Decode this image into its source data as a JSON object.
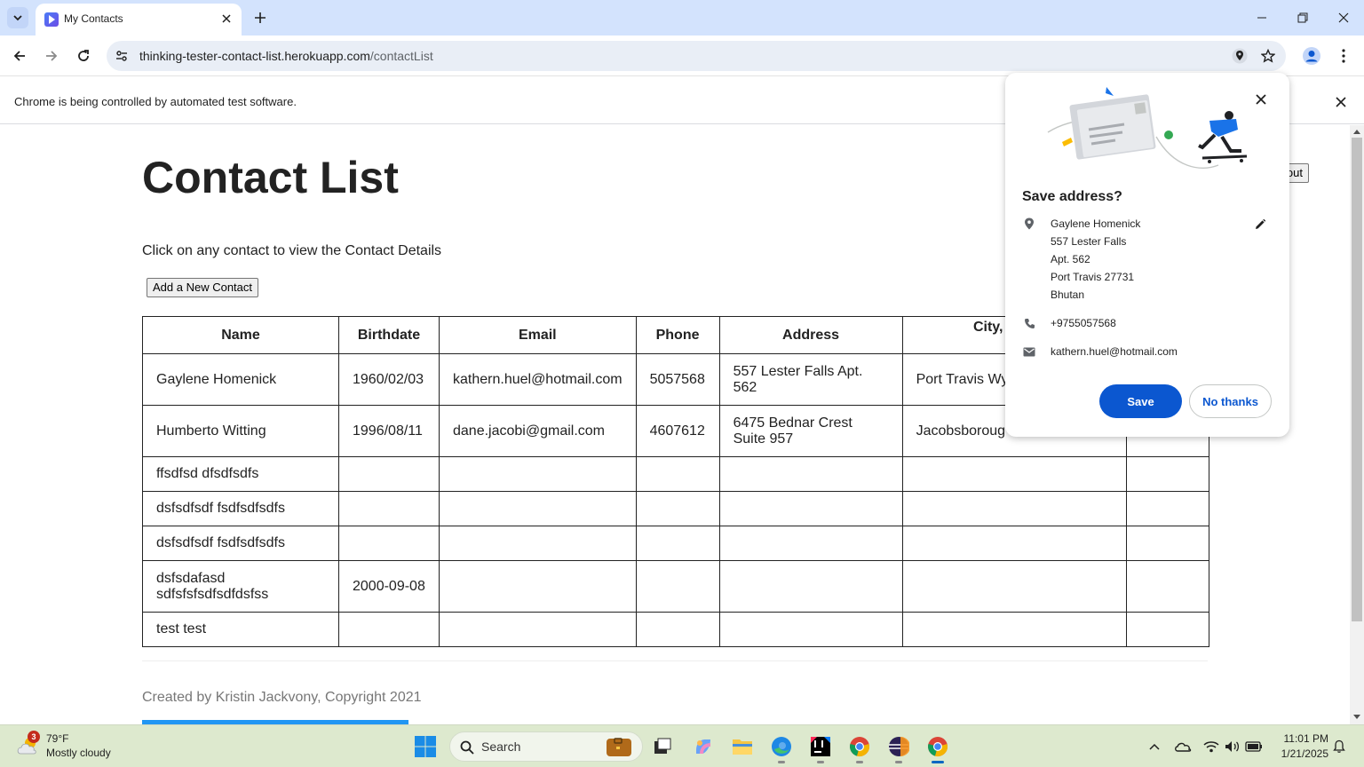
{
  "browser": {
    "tab_title": "My Contacts",
    "url_domain": "thinking-tester-contact-list.herokuapp.com",
    "url_path": "/contactList",
    "infobar_text": "Chrome is being controlled by automated test software."
  },
  "page": {
    "title": "Contact List",
    "subtitle": "Click on any contact to view the Contact Details",
    "add_button": "Add a New Contact",
    "logout_partial": "out",
    "columns": [
      "Name",
      "Birthdate",
      "Email",
      "Phone",
      "Address",
      "City, State/P",
      ""
    ],
    "columns_partial_second_line": "C",
    "rows": [
      {
        "name": "Gaylene Homenick",
        "birthdate": "1960/02/03",
        "email": "kathern.huel@hotmail.com",
        "phone": "5057568",
        "address": "557 Lester Falls Apt. 562",
        "city": "Port Travis Wy",
        "country": ""
      },
      {
        "name": "Humberto Witting",
        "birthdate": "1996/08/11",
        "email": "dane.jacobi@gmail.com",
        "phone": "4607612",
        "address": "6475 Bednar Crest Suite 957",
        "city": "Jacobsboroug 32311",
        "country": ""
      },
      {
        "name": "ffsdfsd dfsdfsdfs",
        "birthdate": "",
        "email": "",
        "phone": "",
        "address": "",
        "city": "",
        "country": ""
      },
      {
        "name": "dsfsdfsdf fsdfsdfsdfs",
        "birthdate": "",
        "email": "",
        "phone": "",
        "address": "",
        "city": "",
        "country": ""
      },
      {
        "name": "dsfsdfsdf fsdfsdfsdfs",
        "birthdate": "",
        "email": "",
        "phone": "",
        "address": "",
        "city": "",
        "country": ""
      },
      {
        "name": "dsfsdafasd sdfsfsfsdfsdfdsfss",
        "birthdate": "2000-09-08",
        "email": "",
        "phone": "",
        "address": "",
        "city": "",
        "country": ""
      },
      {
        "name": "test test",
        "birthdate": "",
        "email": "",
        "phone": "",
        "address": "",
        "city": "",
        "country": ""
      }
    ],
    "footer": "Created by Kristin Jackvony, Copyright 2021"
  },
  "popup": {
    "title": "Save address?",
    "address_lines": [
      "Gaylene Homenick",
      "557 Lester Falls",
      "Apt. 562",
      "Port Travis 27731",
      "Bhutan"
    ],
    "phone": "+9755057568",
    "email": "kathern.huel@hotmail.com",
    "save_label": "Save",
    "no_thanks_label": "No thanks"
  },
  "taskbar": {
    "weather_temp": "79°F",
    "weather_desc": "Mostly cloudy",
    "weather_badge": "3",
    "search_placeholder": "Search",
    "time": "11:01 PM",
    "date": "1/21/2025"
  },
  "colors": {
    "tabbar_bg": "#d3e3fd",
    "accent_blue": "#0b57d0",
    "taskbar_bg": "#dde9ce"
  }
}
